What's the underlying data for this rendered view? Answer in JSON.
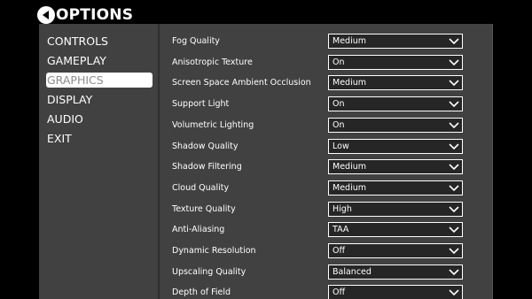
{
  "header": {
    "title": "OPTIONS",
    "back_icon": "back-arrow-circle-icon"
  },
  "sidebar": {
    "items": [
      {
        "label": "CONTROLS",
        "active": false
      },
      {
        "label": "GAMEPLAY",
        "active": false
      },
      {
        "label": "GRAPHICS",
        "active": true
      },
      {
        "label": "DISPLAY",
        "active": false
      },
      {
        "label": "AUDIO",
        "active": false
      },
      {
        "label": "EXIT",
        "active": false
      }
    ]
  },
  "settings": [
    {
      "label": "Fog Quality",
      "value": "Medium"
    },
    {
      "label": "Anisotropic Texture",
      "value": "On"
    },
    {
      "label": "Screen Space Ambient Occlusion",
      "value": "Medium"
    },
    {
      "label": "Support Light",
      "value": "On"
    },
    {
      "label": "Volumetric Lighting",
      "value": "On"
    },
    {
      "label": "Shadow Quality",
      "value": "Low"
    },
    {
      "label": "Shadow Filtering",
      "value": "Medium"
    },
    {
      "label": "Cloud Quality",
      "value": "Medium"
    },
    {
      "label": "Texture Quality",
      "value": "High"
    },
    {
      "label": "Anti-Aliasing",
      "value": "TAA"
    },
    {
      "label": "Dynamic Resolution",
      "value": "Off"
    },
    {
      "label": "Upscaling Quality",
      "value": "Balanced"
    },
    {
      "label": "Depth of Field",
      "value": "Off"
    }
  ],
  "colors": {
    "panel": "#414141",
    "background": "#000000",
    "select_bg": "#262626",
    "active_item_bg": "#ffffff",
    "active_item_text": "#8c8c8c"
  }
}
